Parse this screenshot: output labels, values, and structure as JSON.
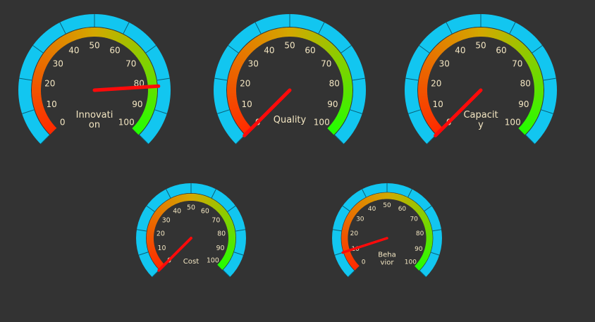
{
  "chart_data": [
    {
      "type": "gauge",
      "name_lines": [
        "Innovati",
        "on"
      ],
      "value": 82,
      "range": [
        0,
        100
      ],
      "tick_labels": [
        "0",
        "10",
        "20",
        "30",
        "40",
        "50",
        "60",
        "70",
        "80",
        "90",
        "100"
      ]
    },
    {
      "type": "gauge",
      "name_lines": [
        "Quality"
      ],
      "value": 0,
      "range": [
        0,
        100
      ],
      "tick_labels": [
        "0",
        "10",
        "20",
        "30",
        "40",
        "50",
        "60",
        "70",
        "80",
        "90",
        "100"
      ]
    },
    {
      "type": "gauge",
      "name_lines": [
        "Capacit",
        "y"
      ],
      "value": 0,
      "range": [
        0,
        100
      ],
      "tick_labels": [
        "0",
        "10",
        "20",
        "30",
        "40",
        "50",
        "60",
        "70",
        "80",
        "90",
        "100"
      ]
    },
    {
      "type": "gauge",
      "name_lines": [
        "Cost"
      ],
      "value": 0,
      "range": [
        0,
        100
      ],
      "tick_labels": [
        "0",
        "10",
        "20",
        "30",
        "40",
        "50",
        "60",
        "70",
        "80",
        "90",
        "100"
      ]
    },
    {
      "type": "gauge",
      "name_lines": [
        "Beha",
        "vior"
      ],
      "value": 10,
      "range": [
        0,
        100
      ],
      "tick_labels": [
        "0",
        "10",
        "20",
        "30",
        "40",
        "50",
        "60",
        "70",
        "80",
        "90",
        "100"
      ]
    }
  ],
  "colors": {
    "background": "#333333",
    "outer_band": "#12c6f0",
    "band_divider": "#0a5e75",
    "arc_low": "#ff2a00",
    "arc_mid": "#d4a800",
    "arc_high": "#22ff00",
    "needle": "#ff0a0a",
    "text": "#f3e6c2"
  }
}
